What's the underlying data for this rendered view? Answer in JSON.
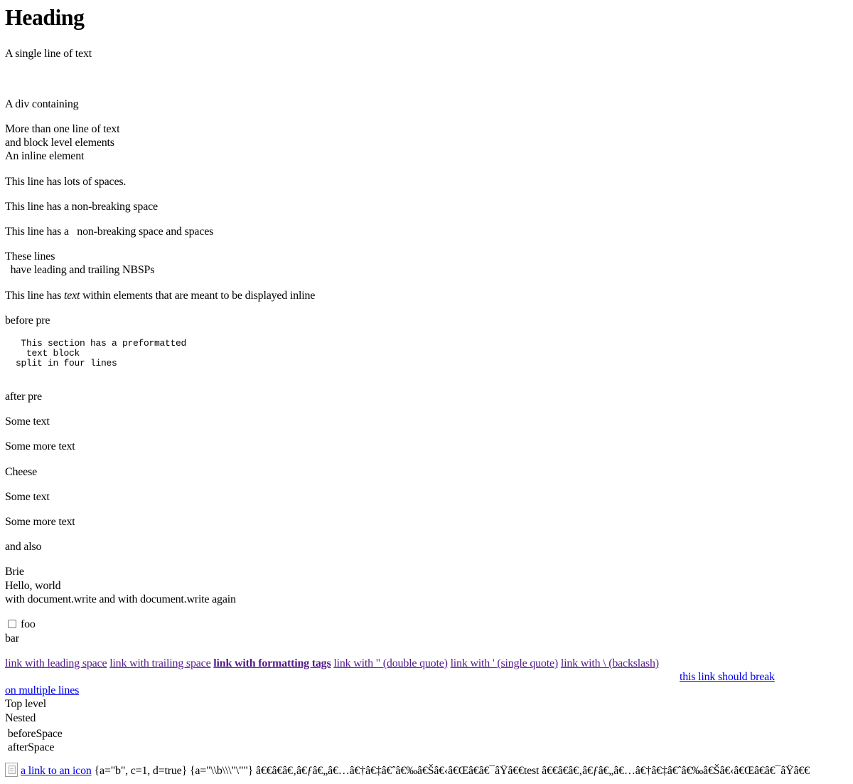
{
  "heading": "Heading",
  "lines": {
    "single_line": "A single line of text",
    "div_containing": "A div containing",
    "more_than_one": "More than one line of text",
    "and_block": "and block level elements",
    "an_inline": "An inline element",
    "lots_of_spaces": "This line has lots of spaces.",
    "nbsp": "This line has a non-breaking space",
    "nbsp_and_spaces": "This line has a   non-breaking space and spaces",
    "these_lines": "These lines",
    "leading_trailing": "  have leading and trailing NBSPs",
    "inline_prefix": "This line has ",
    "inline_em": "text",
    "inline_suffix": " within elements that are meant to be displayed inline",
    "before_pre": "before pre",
    "pre_block": "   This section has a preformatted\n    text block\n  split in four lines",
    "after_pre": "after pre",
    "some_text_1": "Some text",
    "some_more_text_1": "Some more text",
    "cheese": "Cheese",
    "some_text_2": "Some text",
    "some_more_text_2": "Some more text",
    "and_also": "and also",
    "brie": "Brie",
    "hello_world": "Hello, world",
    "document_write": "with document.write and with document.write again",
    "checkbox_label": "foo",
    "bar": "bar",
    "top_level": "Top level",
    "nested": "Nested",
    "before_space": " beforeSpace",
    "after_space": " afterSpace",
    "object_text_1": " {a=\"b\", c=1, d=true} {a=\"\\\\b\\\\\\\"\\\"\"} ",
    "garbled_text": "â€€â€â€‚â€ƒâ€„â€…â€†â€‡â€ˆâ€‰â€Šâ€‹â€Œâ€â€¯âŸâ€€test â€€â€â€‚â€ƒâ€„â€…â€†â€‡â€ˆâ€‰â€Šâ€‹â€Œâ€â€¯âŸâ€€"
  },
  "links": {
    "leading_space": "link with leading space",
    "trailing_space": "link with trailing space",
    "formatting_tags": "link with formatting tags",
    "double_quote": "link with \" (double quote)",
    "single_quote": "link with ' (single quote)",
    "backslash": "link with \\ (backslash)",
    "break_line_1": "this link should break",
    "break_line_2": "on multiple lines",
    "icon_link": "a link to an icon"
  },
  "colors": {
    "visited_link": "#551a8b",
    "unvisited_link": "#0000ee"
  },
  "icons": {
    "broken_image": "broken-image-icon"
  }
}
